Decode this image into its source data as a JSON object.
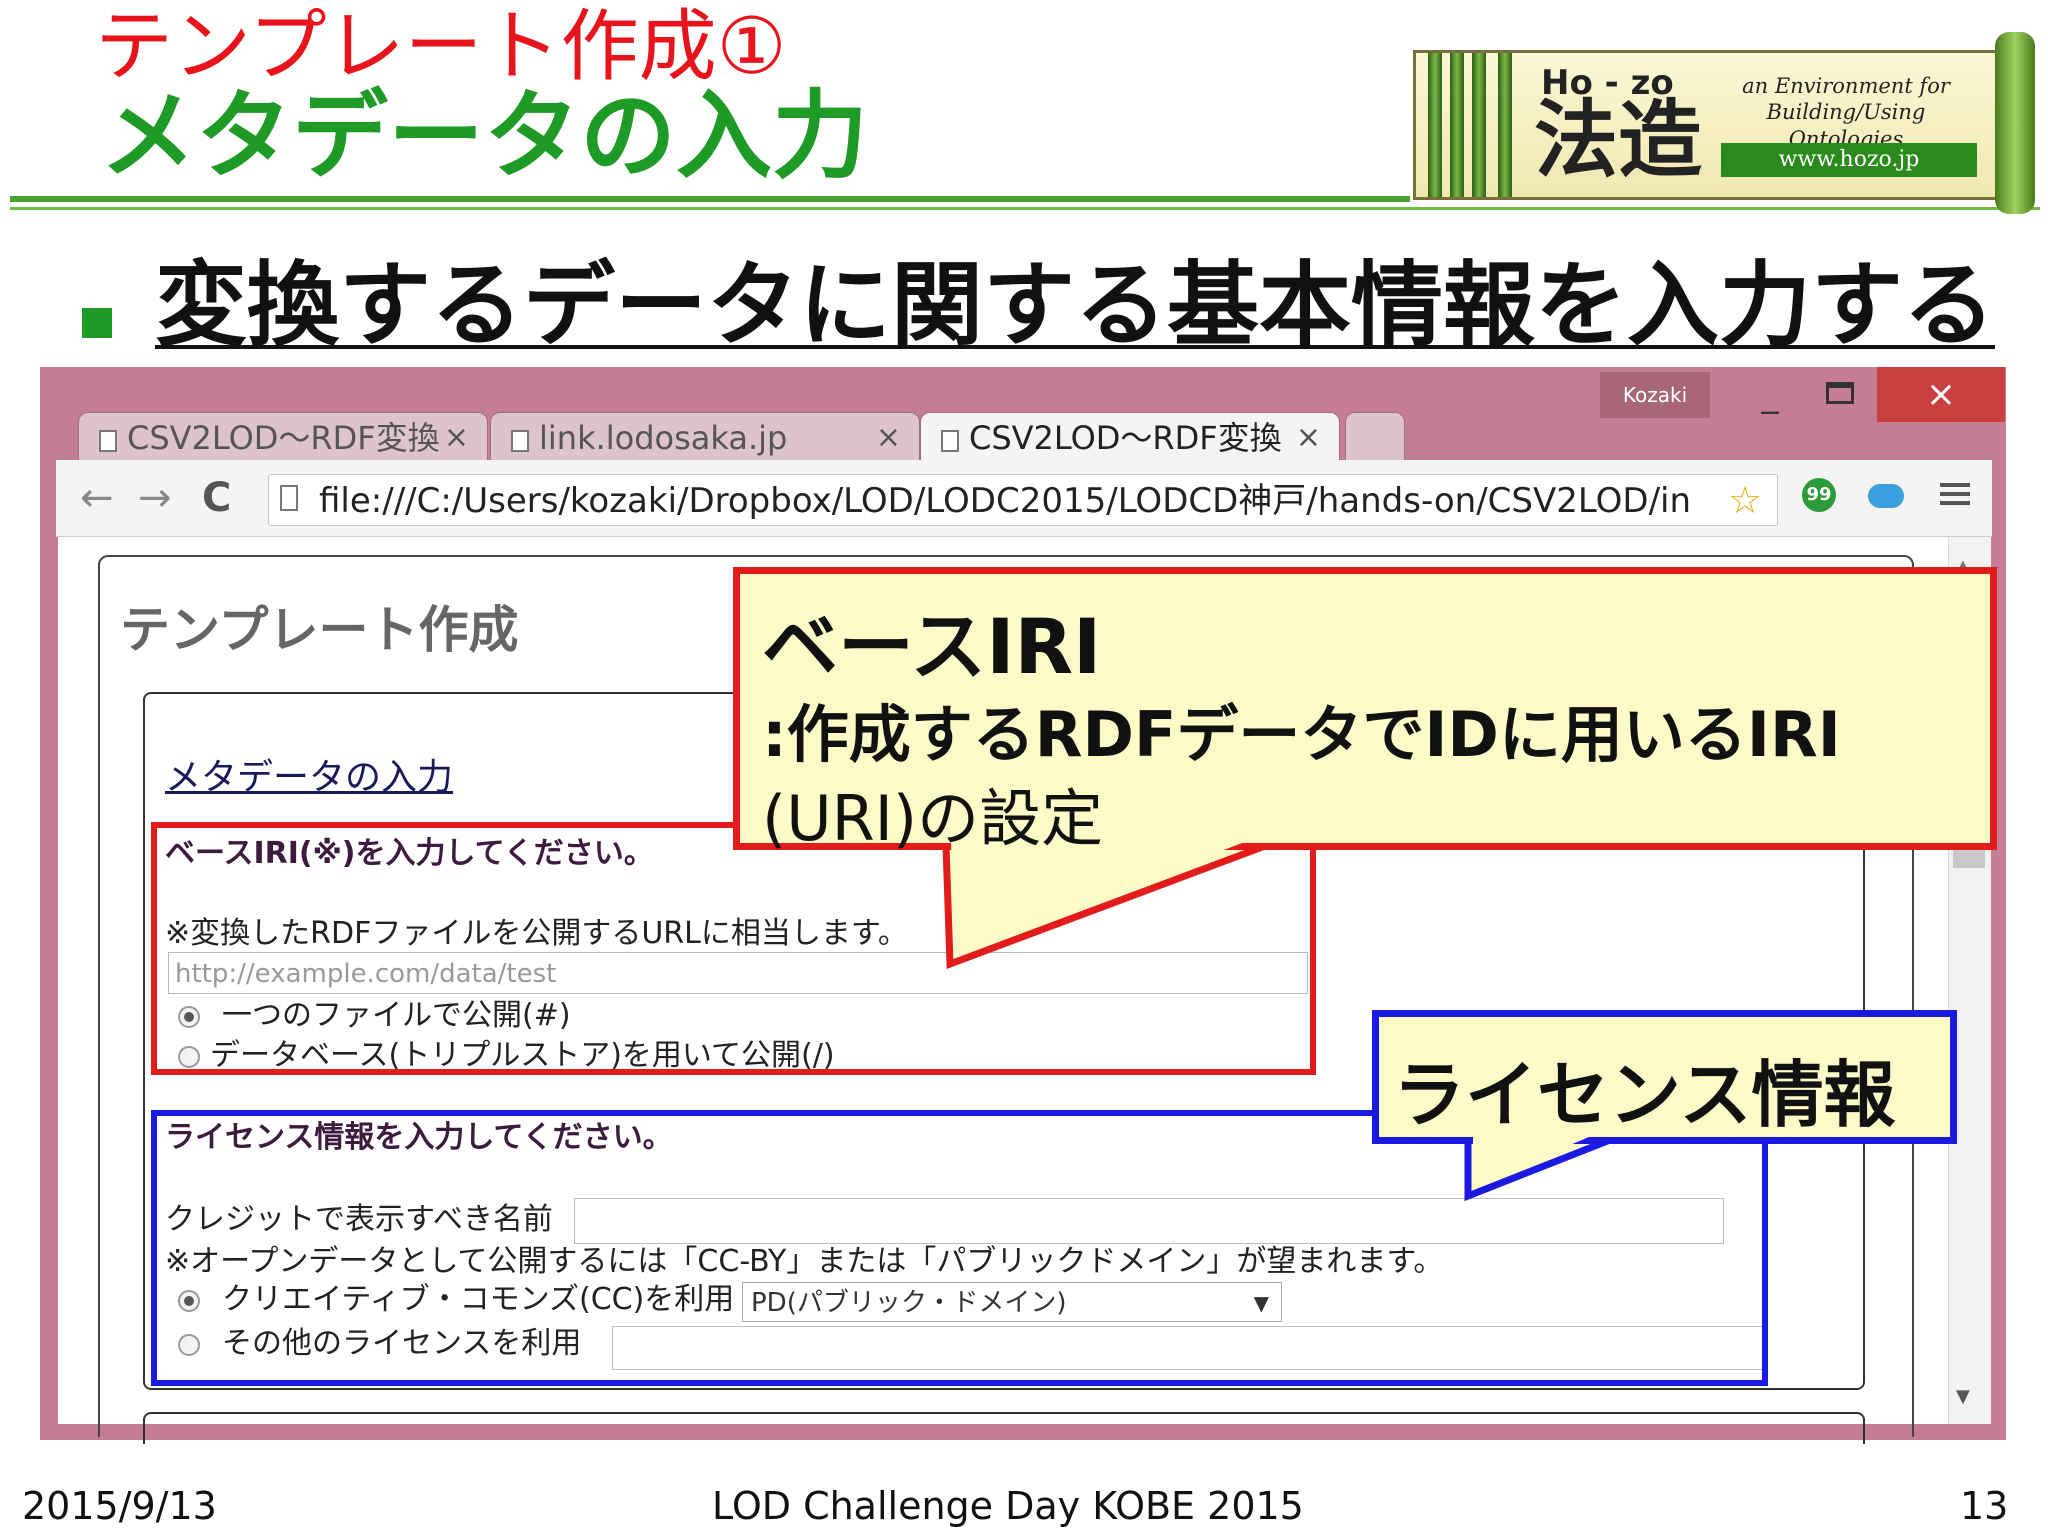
{
  "slide": {
    "title_line1": "テンプレート作成①",
    "title_line2": "メタデータの入力",
    "bullet": "変換するデータに関する基本情報を入力する",
    "footer_date": "2015/9/13",
    "footer_event": "LOD Challenge Day KOBE 2015",
    "page_number": "13"
  },
  "logo": {
    "ho_zo": "Ho - zo",
    "kanji": "法造",
    "tagline": "an Environment for Building/Using Ontologies",
    "url": "www.hozo.jp"
  },
  "browser": {
    "user": "Kozaki",
    "tabs": [
      {
        "label": "CSV2LOD～RDF変換",
        "active": false
      },
      {
        "label": "link.lodosaka.jp",
        "active": false
      },
      {
        "label": "CSV2LOD～RDF変換",
        "active": true
      }
    ],
    "tab_close": "×",
    "window_controls": {
      "minimize": "_",
      "close": "×"
    },
    "nav": {
      "back": "←",
      "forward": "→",
      "reload": "C"
    },
    "url": "file:///C:/Users/kozaki/Dropbox/LOD/LODC2015/LODCD神戸/hands-on/CSV2LOD/in",
    "extension_badge": "99"
  },
  "page": {
    "title": "テンプレート作成",
    "section_link": "メタデータの入力",
    "base_iri": {
      "prompt": "ベースIRI(※)を入力してください。",
      "note": "※変換したRDFファイルを公開するURLに相当します。",
      "placeholder": "http://example.com/data/test",
      "options": [
        "一つのファイルで公開(#)",
        "データベース(トリプルストア)を用いて公開(/)"
      ],
      "selected_index": 0
    },
    "license": {
      "prompt": "ライセンス情報を入力してください。",
      "credit_label": "クレジットで表示すべき名前",
      "note": "※オープンデータとして公開するには「CC-BY」または「パブリックドメイン」が望まれます。",
      "cc_option": "クリエイティブ・コモンズ(CC)を利用",
      "cc_select_value": "PD(パブリック・ドメイン)",
      "other_option": "その他のライセンスを利用",
      "selected_index": 0
    }
  },
  "callouts": {
    "red_title": "ベースIRI",
    "red_line1": ":作成するRDFデータでIDに用いるIRI",
    "red_line2": "(URI)の設定",
    "blue_title": "ライセンス情報"
  },
  "colors": {
    "title_red": "#e8141b",
    "title_green": "#1e9a26",
    "browser_frame": "#c47d92",
    "annotation_red": "#e21b1b",
    "annotation_blue": "#1a1ae0",
    "callout_fill": "#fcfbc7"
  }
}
